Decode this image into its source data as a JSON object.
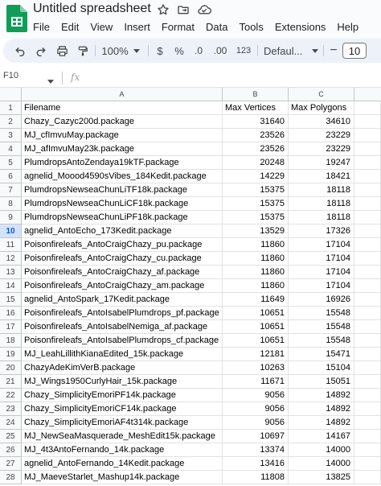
{
  "app": {
    "title": "Untitled spreadsheet",
    "menu": [
      "File",
      "Edit",
      "View",
      "Insert",
      "Format",
      "Data",
      "Tools",
      "Extensions",
      "Help"
    ]
  },
  "toolbar": {
    "zoom": "100%",
    "currency": "$",
    "percent": "%",
    "decrease_decimal": ".0",
    "increase_decimal": ".00",
    "number_format": "123",
    "font": "Defaul...",
    "font_size": "10",
    "minus": "−"
  },
  "formula_bar": {
    "cell_ref": "F10",
    "fx": "fx",
    "content": ""
  },
  "grid": {
    "columns": [
      "A",
      "B",
      "C"
    ],
    "selected_row": "10",
    "header_row": {
      "num": "1",
      "a": "Filename",
      "b": "Max Vertices",
      "c": "Max Polygons"
    },
    "rows": [
      {
        "num": "2",
        "a": "Chazy_Cazyc200d.package",
        "b": "31640",
        "c": "34610"
      },
      {
        "num": "3",
        "a": "MJ_cfImvuMay.package",
        "b": "23526",
        "c": "23229"
      },
      {
        "num": "4",
        "a": "MJ_afImvuMay23k.package",
        "b": "23526",
        "c": "23229"
      },
      {
        "num": "5",
        "a": "PlumdropsAntoZendaya19kTF.package",
        "b": "20248",
        "c": "19247"
      },
      {
        "num": "6",
        "a": "agnelid_Moood4590sVibes_184Kedit.package",
        "b": "14229",
        "c": "18421"
      },
      {
        "num": "7",
        "a": "PlumdropsNewseaChunLiTF18k.package",
        "b": "15375",
        "c": "18118"
      },
      {
        "num": "8",
        "a": "PlumdropsNewseaChunLiCF18k.package",
        "b": "15375",
        "c": "18118"
      },
      {
        "num": "9",
        "a": "PlumdropsNewseaChunLiPF18k.package",
        "b": "15375",
        "c": "18118"
      },
      {
        "num": "10",
        "a": "agnelid_AntoEcho_173Kedit.package",
        "b": "13529",
        "c": "17326"
      },
      {
        "num": "11",
        "a": "Poisonfireleafs_AntoCraigChazy_pu.package",
        "b": "11860",
        "c": "17104"
      },
      {
        "num": "12",
        "a": "Poisonfireleafs_AntoCraigChazy_cu.package",
        "b": "11860",
        "c": "17104"
      },
      {
        "num": "13",
        "a": "Poisonfireleafs_AntoCraigChazy_af.package",
        "b": "11860",
        "c": "17104"
      },
      {
        "num": "14",
        "a": "Poisonfireleafs_AntoCraigChazy_am.package",
        "b": "11860",
        "c": "17104"
      },
      {
        "num": "15",
        "a": "agnelid_AntoSpark_17Kedit.package",
        "b": "11649",
        "c": "16926"
      },
      {
        "num": "16",
        "a": "Poisonfireleafs_AntoIsabelPlumdrops_pf.package",
        "b": "10651",
        "c": "15548"
      },
      {
        "num": "17",
        "a": "Poisonfireleafs_AntoIsabelNemiga_af.package",
        "b": "10651",
        "c": "15548"
      },
      {
        "num": "18",
        "a": "Poisonfireleafs_AntoIsabelPlumdrops_cf.package",
        "b": "10651",
        "c": "15548"
      },
      {
        "num": "19",
        "a": "MJ_LeahLillithKianaEdited_15k.package",
        "b": "12181",
        "c": "15471"
      },
      {
        "num": "20",
        "a": "ChazyAdeKimVerB.package",
        "b": "10263",
        "c": "15104"
      },
      {
        "num": "21",
        "a": "MJ_Wings1950CurlyHair_15k.package",
        "b": "11671",
        "c": "15051"
      },
      {
        "num": "22",
        "a": "Chazy_SimplicityEmoriPF14k.package",
        "b": "9056",
        "c": "14892"
      },
      {
        "num": "23",
        "a": "Chazy_SimplicityEmoriCF14k.package",
        "b": "9056",
        "c": "14892"
      },
      {
        "num": "24",
        "a": "Chazy_SimplicityEmoriAF4t314k.package",
        "b": "9056",
        "c": "14892"
      },
      {
        "num": "25",
        "a": "MJ_NewSeaMasquerade_MeshEdit15k.package",
        "b": "10697",
        "c": "14167"
      },
      {
        "num": "26",
        "a": "MJ_4t3AntoFernando_14k.package",
        "b": "13374",
        "c": "14000"
      },
      {
        "num": "27",
        "a": "agnelid_AntoFernando_14Kedit.package",
        "b": "13416",
        "c": "14000"
      },
      {
        "num": "28",
        "a": "MJ_MaeveStarlet_Mashup14k.package",
        "b": "11808",
        "c": "13825"
      }
    ]
  }
}
